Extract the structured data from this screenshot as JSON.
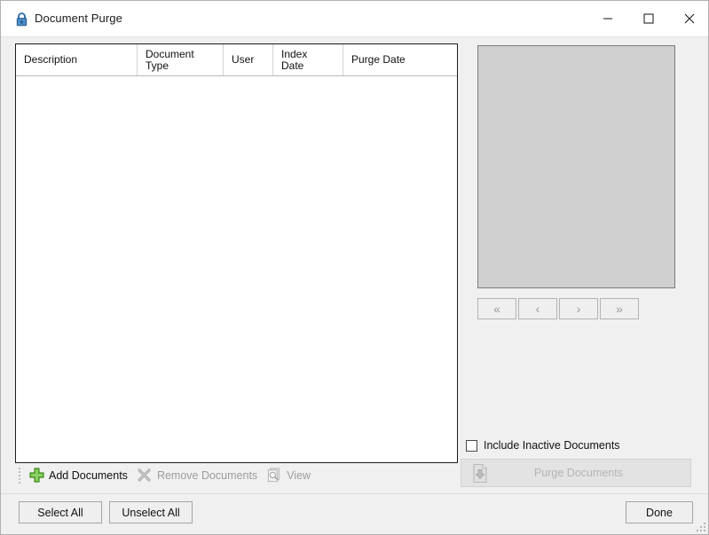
{
  "window": {
    "title": "Document Purge",
    "lock_icon": "lock-icon",
    "caption": {
      "minimize": "minimize-icon",
      "maximize": "maximize-icon",
      "close": "close-icon"
    }
  },
  "grid": {
    "columns": [
      {
        "label": "Description"
      },
      {
        "label": "Document\nType"
      },
      {
        "label": "User"
      },
      {
        "label": "Index\nDate"
      },
      {
        "label": "Purge Date"
      }
    ],
    "rows": []
  },
  "toolbar": {
    "items": [
      {
        "label": "Add Documents",
        "icon": "green-plus-icon",
        "enabled": true
      },
      {
        "label": "Remove Documents",
        "icon": "gray-x-icon",
        "enabled": false
      },
      {
        "label": "View",
        "icon": "document-magnifier-icon",
        "enabled": false
      }
    ]
  },
  "preview": {
    "nav": [
      {
        "label": "«",
        "name": "first-page-button"
      },
      {
        "label": "‹",
        "name": "previous-page-button"
      },
      {
        "label": "›",
        "name": "next-page-button"
      },
      {
        "label": "»",
        "name": "last-page-button"
      }
    ]
  },
  "options": {
    "include_inactive_label": "Include Inactive Documents",
    "include_inactive_checked": false
  },
  "purge": {
    "label": "Purge Documents",
    "icon": "document-download-icon",
    "enabled": false
  },
  "bottom": {
    "select_all": "Select All",
    "unselect_all": "Unselect All",
    "done": "Done"
  },
  "colors": {
    "accent_green": "#6cbf3f",
    "window_bg": "#f0f0f0",
    "preview_bg": "#d0d0d0",
    "disabled_text": "#9d9d9d"
  }
}
